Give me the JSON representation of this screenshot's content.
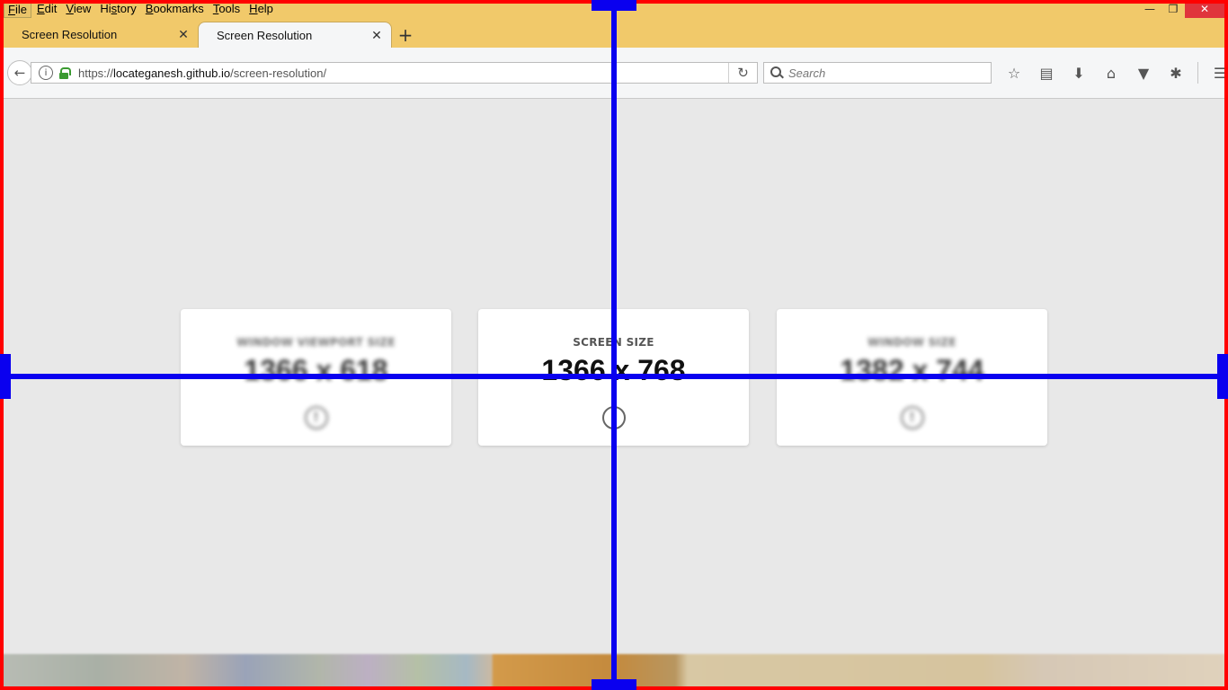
{
  "menubar": {
    "items": [
      {
        "label": "File",
        "underline": "F"
      },
      {
        "label": "Edit",
        "underline": "E"
      },
      {
        "label": "View",
        "underline": "V"
      },
      {
        "label": "History",
        "underline": "s"
      },
      {
        "label": "Bookmarks",
        "underline": "B"
      },
      {
        "label": "Tools",
        "underline": "T"
      },
      {
        "label": "Help",
        "underline": "H"
      }
    ]
  },
  "window_controls": {
    "minimize": "—",
    "restore": "❐",
    "close": "✕"
  },
  "tabs": [
    {
      "label": "Screen Resolution",
      "active": false
    },
    {
      "label": "Screen Resolution",
      "active": true
    }
  ],
  "tab_close_glyph": "✕",
  "new_tab_glyph": "+",
  "navbar": {
    "back_glyph": "←",
    "url_scheme": "https://",
    "url_host": "locateganesh.github.io",
    "url_path": "/screen-resolution/",
    "reload_glyph": "↻",
    "search_placeholder": "Search",
    "toolbar_icons": [
      {
        "name": "bookmark-star-icon",
        "glyph": "☆"
      },
      {
        "name": "reading-list-icon",
        "glyph": "▤"
      },
      {
        "name": "downloads-icon",
        "glyph": "⬇"
      },
      {
        "name": "home-icon",
        "glyph": "⌂"
      },
      {
        "name": "pocket-icon",
        "glyph": "▼"
      },
      {
        "name": "extension-icon",
        "glyph": "✱"
      },
      {
        "name": "menu-icon",
        "glyph": "☰"
      }
    ]
  },
  "cards": {
    "viewport": {
      "label": "WINDOW VIEWPORT SIZE",
      "value": "1366 x 618"
    },
    "screen": {
      "label": "SCREEN SIZE",
      "value": "1366 x 768"
    },
    "window": {
      "label": "WINDOW SIZE",
      "value": "1382 x 744"
    },
    "info_glyph": "!"
  },
  "colors": {
    "titlebar": "#f1c96a",
    "frame": "#ff0000",
    "crosshair": "#0a00ef",
    "page_background": "#e8e8e8"
  }
}
